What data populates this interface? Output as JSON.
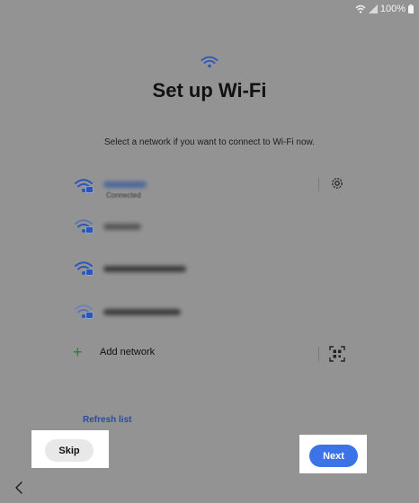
{
  "status_bar": {
    "battery_text": "100%",
    "icons": [
      "wifi-icon",
      "signal-icon",
      "battery-icon"
    ]
  },
  "header": {
    "icon": "wifi-icon",
    "title": "Set up Wi-Fi",
    "subtitle": "Select a network if you want to connect to Wi-Fi now."
  },
  "networks": [
    {
      "status": "Connected",
      "secured": true,
      "settings_icon": "gear-icon"
    },
    {
      "status": "",
      "secured": true
    },
    {
      "status": "",
      "secured": true
    },
    {
      "status": "",
      "secured": true
    }
  ],
  "add_network": {
    "label": "Add network",
    "icon": "plus-icon",
    "scan_icon": "qr-code-icon"
  },
  "refresh_label": "Refresh list",
  "footer": {
    "skip_label": "Skip",
    "next_label": "Next",
    "back_icon": "chevron-left-icon"
  },
  "colors": {
    "background": "#939393",
    "accent": "#3c73e6",
    "link": "#2a4c9b",
    "add_icon": "#2f7a45"
  }
}
